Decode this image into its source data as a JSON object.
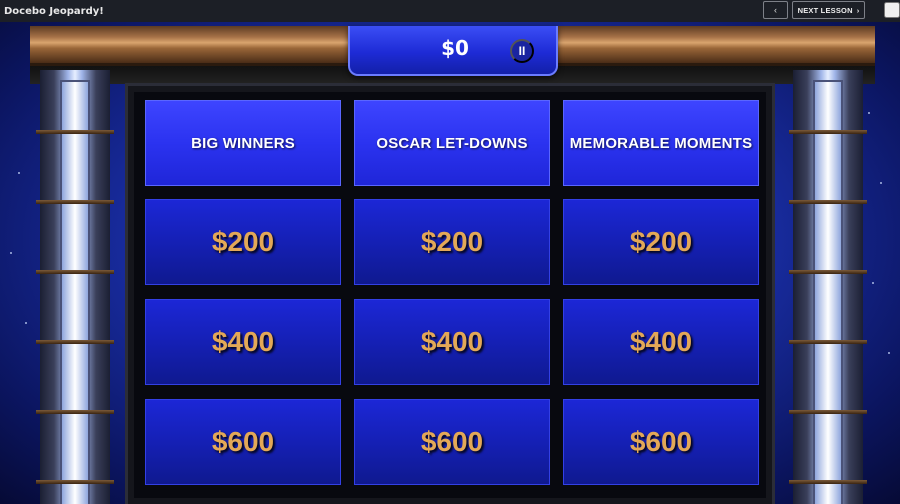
{
  "window": {
    "title": "Docebo Jeopardy!",
    "prev_label": "‹",
    "next_label": "NEXT LESSON",
    "next_chevron": "›",
    "close_label": "✕"
  },
  "score": {
    "amount": "$0",
    "pause_label": "II"
  },
  "board": {
    "categories": [
      "BIG WINNERS",
      "OSCAR LET-DOWNS",
      "MEMORABLE MOMENTS"
    ],
    "rows": [
      [
        "$200",
        "$200",
        "$200"
      ],
      [
        "$400",
        "$400",
        "$400"
      ],
      [
        "$600",
        "$600",
        "$600"
      ]
    ]
  },
  "colors": {
    "category_bg": "#2b33f0",
    "value_bg": "#1520b5",
    "value_text": "#e3a857",
    "topbar_bg": "#1c1f26"
  },
  "icons": {
    "prev": "chevron-left-icon",
    "next": "chevron-right-icon",
    "close": "close-icon",
    "pause": "pause-icon"
  }
}
